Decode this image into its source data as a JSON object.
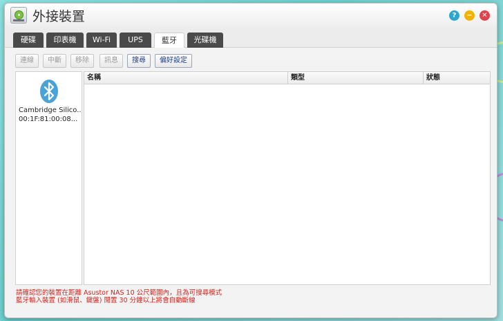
{
  "window": {
    "title": "外接裝置",
    "help_label": "?",
    "min_label": "−",
    "close_label": "✕"
  },
  "tabs": [
    {
      "label": "硬碟",
      "active": false
    },
    {
      "label": "印表機",
      "active": false
    },
    {
      "label": "Wi-Fi",
      "active": false
    },
    {
      "label": "UPS",
      "active": false
    },
    {
      "label": "藍牙",
      "active": true
    },
    {
      "label": "光碟機",
      "active": false
    }
  ],
  "toolbar": {
    "connect": "連線",
    "disconnect": "中斷",
    "remove": "移除",
    "info": "訊息",
    "search": "搜尋",
    "preferences": "偏好設定"
  },
  "device": {
    "name": "Cambridge Silico...",
    "mac": "00:1F:81:00:08..."
  },
  "table": {
    "columns": [
      "名稱",
      "類型",
      "狀態"
    ]
  },
  "notes": [
    "請確認您的裝置在距離 Asustor NAS 10 公尺範圍內，且為可搜尋模式",
    "藍牙輸入裝置 (如滑鼠、鍵盤) 閒置 30 分鐘以上將會自動斷線"
  ],
  "colors": {
    "bluetooth": "#4aa3d8",
    "warning_text": "#d6231c",
    "tab_dark": "#4a4a4a"
  },
  "icons": {
    "app": "external-devices-icon",
    "device": "bluetooth-icon"
  }
}
